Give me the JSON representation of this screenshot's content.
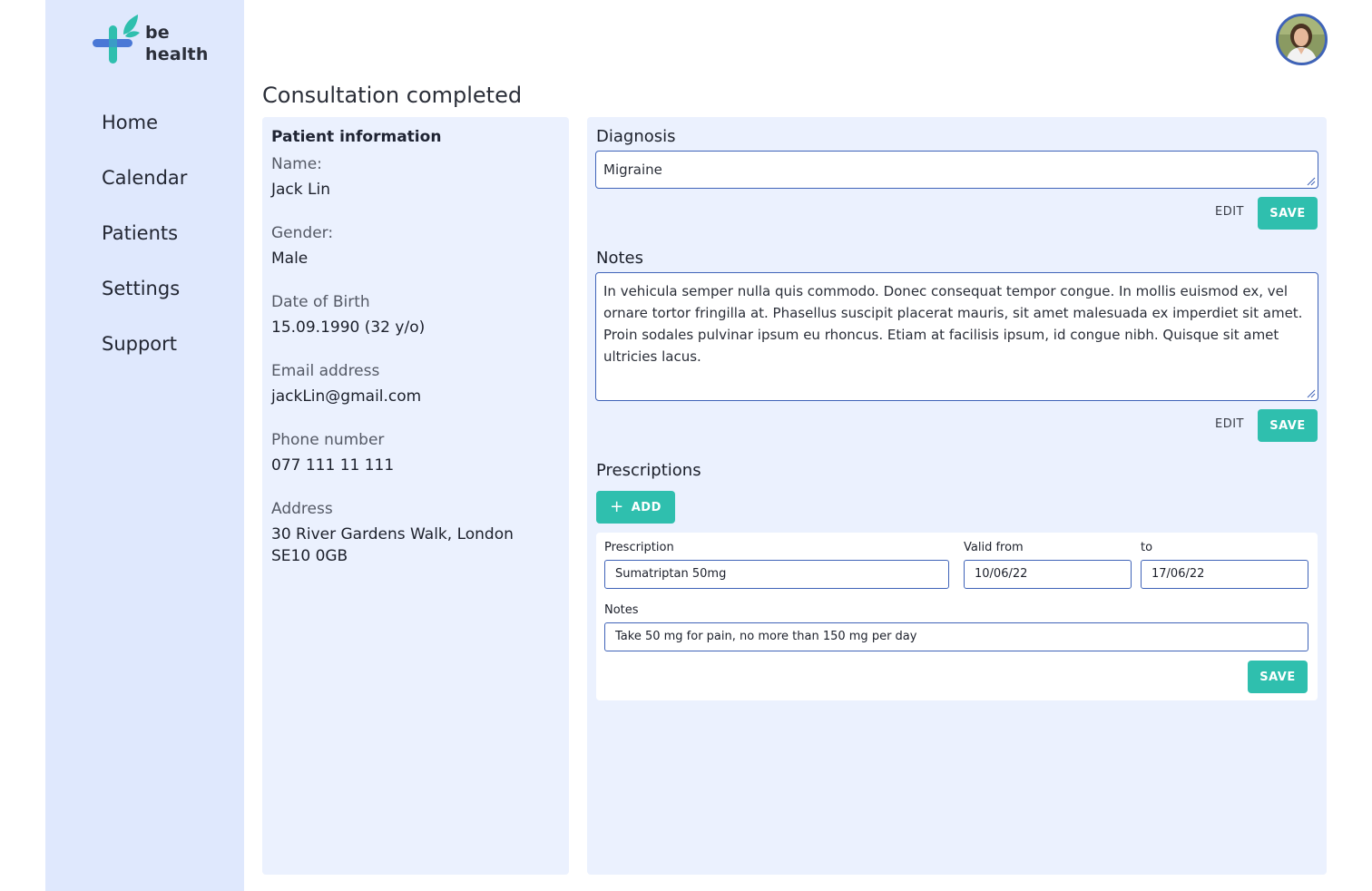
{
  "brand": {
    "line1": "be",
    "line2": "health"
  },
  "nav": {
    "items": [
      {
        "label": "Home"
      },
      {
        "label": "Calendar"
      },
      {
        "label": "Patients"
      },
      {
        "label": "Settings"
      },
      {
        "label": "Support"
      }
    ]
  },
  "page": {
    "title": "Consultation completed"
  },
  "patient": {
    "heading": "Patient information",
    "name_label": "Name:",
    "name": "Jack Lin",
    "gender_label": "Gender:",
    "gender": "Male",
    "dob_label": "Date of Birth",
    "dob": "15.09.1990 (32 y/o)",
    "email_label": "Email address",
    "email": "jackLin@gmail.com",
    "phone_label": "Phone number",
    "phone": "077 111 11 111",
    "address_label": "Address",
    "address_line1": "30 River Gardens Walk, London",
    "address_line2": "SE10 0GB"
  },
  "diagnosis": {
    "title": "Diagnosis",
    "value": "Migraine",
    "edit_label": "EDIT",
    "save_label": "SAVE"
  },
  "notes": {
    "title": "Notes",
    "value": "In vehicula semper nulla quis commodo. Donec consequat tempor congue. In mollis euismod ex, vel ornare tortor fringilla at. Phasellus suscipit placerat mauris, sit amet malesuada ex imperdiet sit amet. Proin sodales pulvinar ipsum eu rhoncus. Etiam at facilisis ipsum, id congue nibh. Quisque sit amet ultricies lacus.",
    "edit_label": "EDIT",
    "save_label": "SAVE"
  },
  "prescriptions": {
    "title": "Prescriptions",
    "add_label": "ADD",
    "item": {
      "prescription_label": "Prescription",
      "prescription": "Sumatriptan 50mg",
      "valid_from_label": "Valid from",
      "valid_from": "10/06/22",
      "to_label": "to",
      "to": "17/06/22",
      "notes_label": "Notes",
      "notes": "Take 50 mg for pain, no more than 150 mg per day",
      "save_label": "SAVE"
    }
  },
  "colors": {
    "sidebar_bg": "#dfe8fd",
    "panel_bg": "#ebf1fe",
    "accent_teal": "#2fbfae",
    "input_border": "#3f63b8",
    "logo_blue": "#4a78d6",
    "logo_teal": "#2fbfae"
  }
}
